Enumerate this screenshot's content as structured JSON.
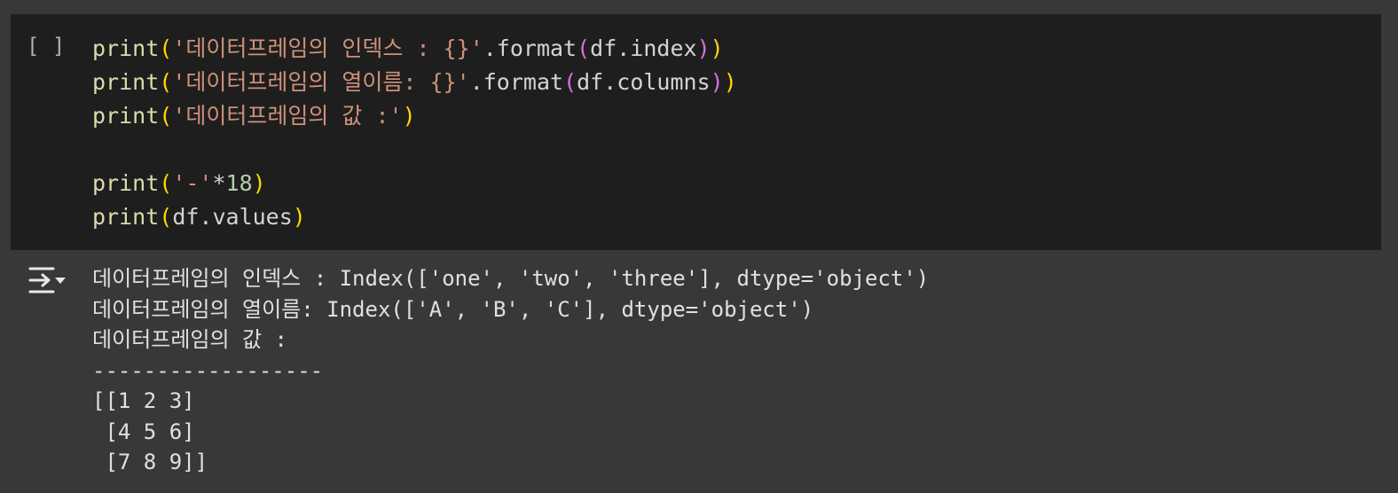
{
  "cell": {
    "run_indicator": "[ ]",
    "code_lines": [
      [
        {
          "t": "print",
          "c": "fn"
        },
        {
          "t": "(",
          "c": "paren1"
        },
        {
          "t": "'데이터프레임의 인덱스 : {}'",
          "c": "str"
        },
        {
          "t": ".format",
          "c": "ident"
        },
        {
          "t": "(",
          "c": "paren2"
        },
        {
          "t": "df.index",
          "c": "ident"
        },
        {
          "t": ")",
          "c": "paren2"
        },
        {
          "t": ")",
          "c": "paren1"
        }
      ],
      [
        {
          "t": "print",
          "c": "fn"
        },
        {
          "t": "(",
          "c": "paren1"
        },
        {
          "t": "'데이터프레임의 열이름: {}'",
          "c": "str"
        },
        {
          "t": ".format",
          "c": "ident"
        },
        {
          "t": "(",
          "c": "paren2"
        },
        {
          "t": "df.columns",
          "c": "ident"
        },
        {
          "t": ")",
          "c": "paren2"
        },
        {
          "t": ")",
          "c": "paren1"
        }
      ],
      [
        {
          "t": "print",
          "c": "fn"
        },
        {
          "t": "(",
          "c": "paren1"
        },
        {
          "t": "'데이터프레임의 값 :'",
          "c": "str"
        },
        {
          "t": ")",
          "c": "paren1"
        }
      ],
      [],
      [
        {
          "t": "print",
          "c": "fn"
        },
        {
          "t": "(",
          "c": "paren1"
        },
        {
          "t": "'-'",
          "c": "str"
        },
        {
          "t": "*",
          "c": "op"
        },
        {
          "t": "18",
          "c": "num"
        },
        {
          "t": ")",
          "c": "paren1"
        }
      ],
      [
        {
          "t": "print",
          "c": "fn"
        },
        {
          "t": "(",
          "c": "paren1"
        },
        {
          "t": "df.values",
          "c": "ident"
        },
        {
          "t": ")",
          "c": "paren1"
        }
      ]
    ]
  },
  "output": {
    "icon": "output-toggle-icon",
    "lines": [
      "데이터프레임의 인덱스 : Index(['one', 'two', 'three'], dtype='object')",
      "데이터프레임의 열이름: Index(['A', 'B', 'C'], dtype='object')",
      "데이터프레임의 값 :",
      "------------------",
      "[[1 2 3]",
      " [4 5 6]",
      " [7 8 9]]"
    ]
  },
  "colors": {
    "page_bg": "#383838",
    "cell_bg": "#1e1e1e",
    "function": "#dcdcaa",
    "paren_outer": "#ffd700",
    "paren_inner": "#da70d6",
    "string": "#ce9178",
    "number": "#b5cea8",
    "text": "#d4d4d4"
  }
}
